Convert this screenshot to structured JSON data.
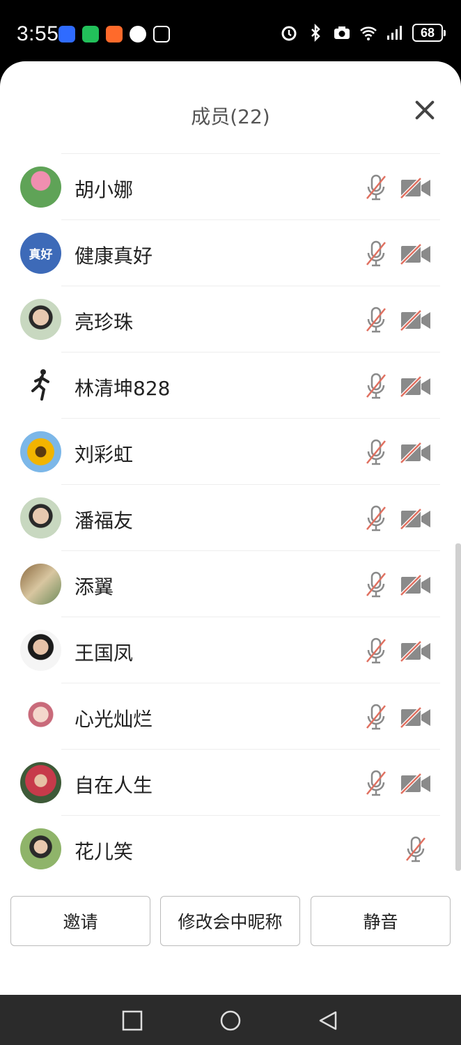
{
  "status": {
    "time": "3:55",
    "battery": "68",
    "icons": [
      "lark-icon",
      "wechat-icon",
      "app-orange-icon",
      "qq-icon",
      "nfc-icon",
      "alarm-icon",
      "bluetooth-icon",
      "camera-icon",
      "wifi-icon",
      "signal-icon"
    ]
  },
  "sheet": {
    "title": "成员(22)"
  },
  "members": [
    {
      "name": "胡小娜",
      "avatar": "lotus",
      "mic_muted": true,
      "camera_off": true
    },
    {
      "name": "健康真好",
      "avatar_text": "真好",
      "avatar": "text",
      "mic_muted": true,
      "camera_off": true
    },
    {
      "name": "亮珍珠",
      "avatar": "person",
      "mic_muted": true,
      "camera_off": true
    },
    {
      "name": "林清坤828",
      "avatar": "runner",
      "mic_muted": true,
      "camera_off": true
    },
    {
      "name": "刘彩虹",
      "avatar": "sunflower",
      "mic_muted": true,
      "camera_off": true
    },
    {
      "name": "潘福友",
      "avatar": "person",
      "mic_muted": true,
      "camera_off": true
    },
    {
      "name": "添翼",
      "avatar": "scenery",
      "mic_muted": true,
      "camera_off": true
    },
    {
      "name": "王国凤",
      "avatar": "portrait",
      "mic_muted": true,
      "camera_off": true
    },
    {
      "name": "心光灿烂",
      "avatar": "cartoon",
      "mic_muted": true,
      "camera_off": true
    },
    {
      "name": "自在人生",
      "avatar": "person-red",
      "mic_muted": true,
      "camera_off": true
    },
    {
      "name": "花儿笑",
      "avatar": "person-green",
      "mic_muted": true,
      "camera_off": false
    }
  ],
  "actions": {
    "invite": "邀请",
    "rename": "修改会中昵称",
    "mute": "静音"
  },
  "colors": {
    "muted_slash": "#e07060",
    "icon_gray": "#8a8a8a"
  }
}
